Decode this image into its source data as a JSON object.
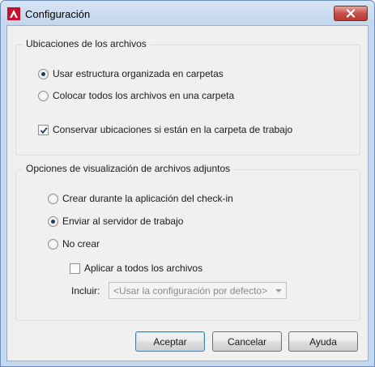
{
  "window": {
    "title": "Configuración",
    "close_icon": "close-icon",
    "app_icon": "autocad-logo-icon"
  },
  "file_locations": {
    "title": "Ubicaciones de los archivos",
    "options": [
      {
        "label": "Usar estructura organizada en carpetas",
        "checked": true
      },
      {
        "label": "Colocar todos los archivos en una carpeta",
        "checked": false
      }
    ],
    "keep_locations": {
      "label": "Conservar ubicaciones si están en la carpeta de trabajo",
      "checked": true
    }
  },
  "attachment_options": {
    "title": "Opciones de visualización de archivos adjuntos",
    "options": [
      {
        "label": "Crear durante la aplicación del check-in",
        "checked": false
      },
      {
        "label": "Enviar al servidor de trabajo",
        "checked": true
      },
      {
        "label": "No crear",
        "checked": false
      }
    ],
    "apply_all": {
      "label": "Aplicar a todos los archivos",
      "checked": false
    },
    "include_label": "Incluir:",
    "include_value": "<Usar la configuración por defecto>"
  },
  "buttons": {
    "ok": "Aceptar",
    "cancel": "Cancelar",
    "help": "Ayuda"
  }
}
